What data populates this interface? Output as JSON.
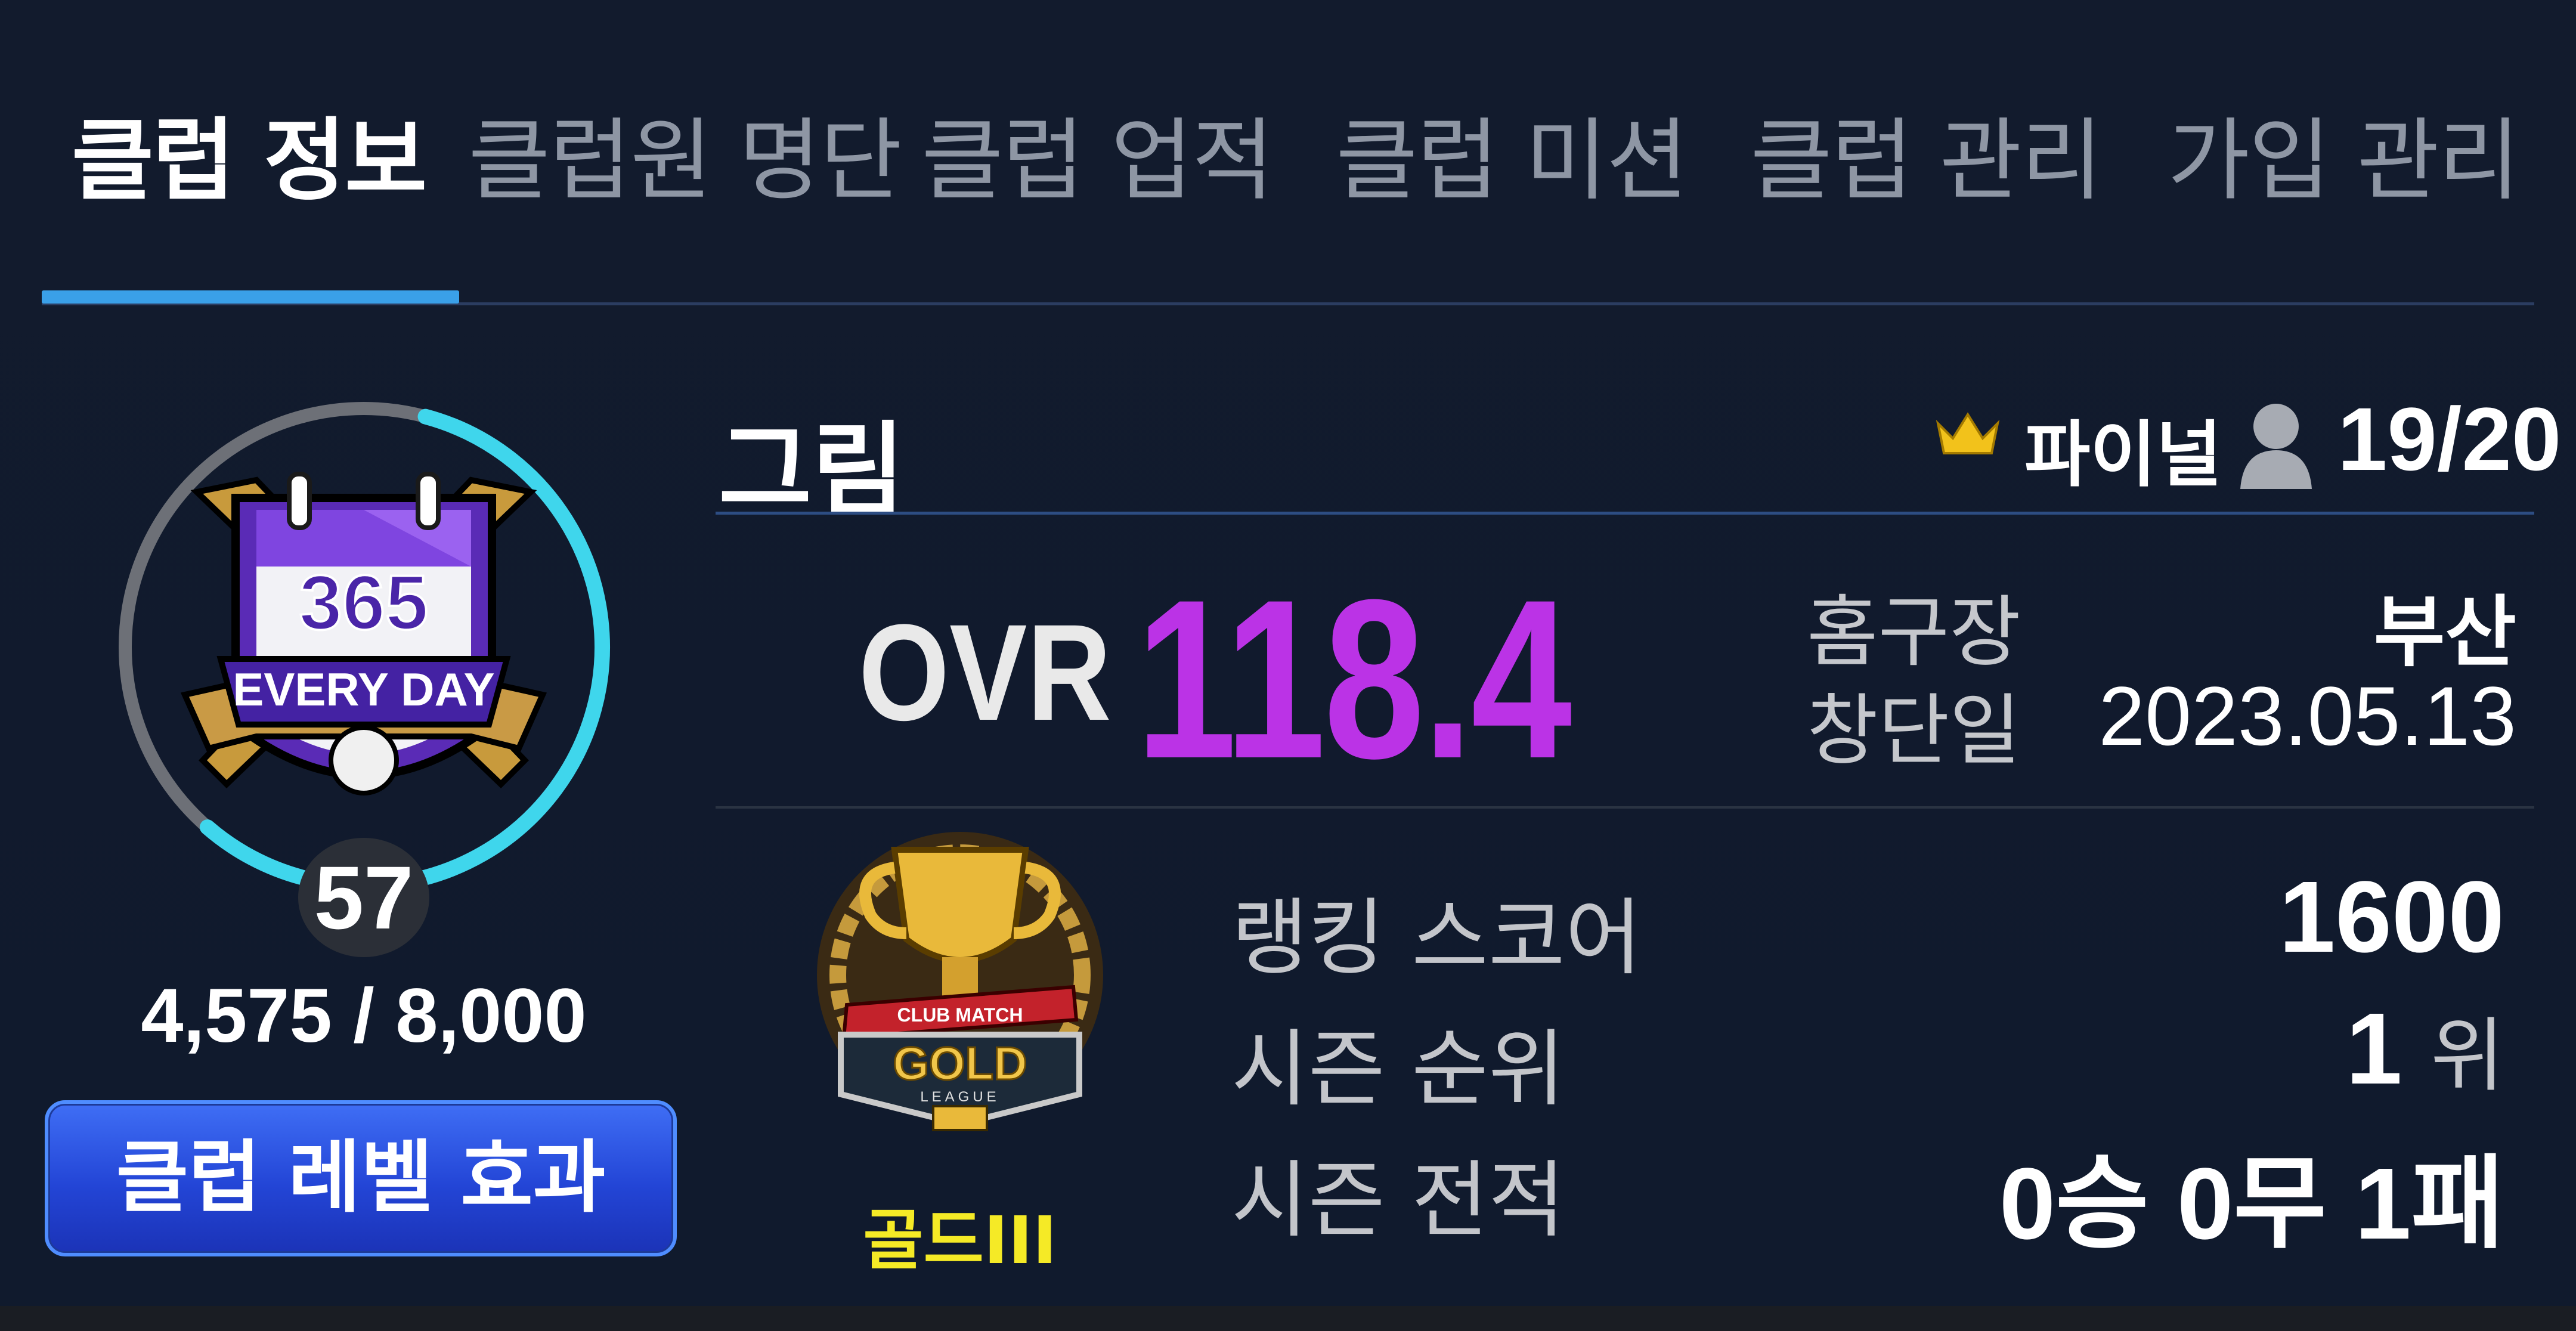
{
  "tabs": [
    {
      "label": "클럽 정보",
      "active": true
    },
    {
      "label": "클럽원 명단",
      "active": false
    },
    {
      "label": "클럽 업적",
      "active": false
    },
    {
      "label": "클럽 미션",
      "active": false
    },
    {
      "label": "클럽 관리",
      "active": false
    },
    {
      "label": "가입 관리",
      "active": false
    }
  ],
  "club": {
    "name": "그림",
    "grade": "파이널",
    "members": "19/20",
    "level": "57",
    "exp": "4,575 / 8,000",
    "exp_progress": 0.572,
    "emblem": {
      "top_text": "365",
      "banner_text": "EVERY DAY"
    },
    "level_effect_button": "클럽 레벨 효과",
    "ovr_label": "OVR",
    "ovr_value": "118.4",
    "home_label": "홈구장",
    "home_value": "부산",
    "founded_label": "창단일",
    "founded_value": "2023.05.13"
  },
  "league": {
    "emblem_ribbon": "CLUB MATCH",
    "emblem_text": "GOLD",
    "emblem_sub": "LEAGUE",
    "tier": "골드III"
  },
  "stats": {
    "score_label": "랭킹 스코어",
    "score_value": "1600",
    "rank_label": "시즌 순위",
    "rank_value": "1",
    "rank_unit": "위",
    "record_label": "시즌 전적",
    "record_value": "0승 0무 1패"
  },
  "colors": {
    "background": "#111a2c",
    "tab_indicator": "#3aa0e8",
    "ring_progress": "#3fd6ec",
    "ovr": "#bb33e6",
    "tier": "#f5ea26",
    "button": "#2d52e0"
  }
}
